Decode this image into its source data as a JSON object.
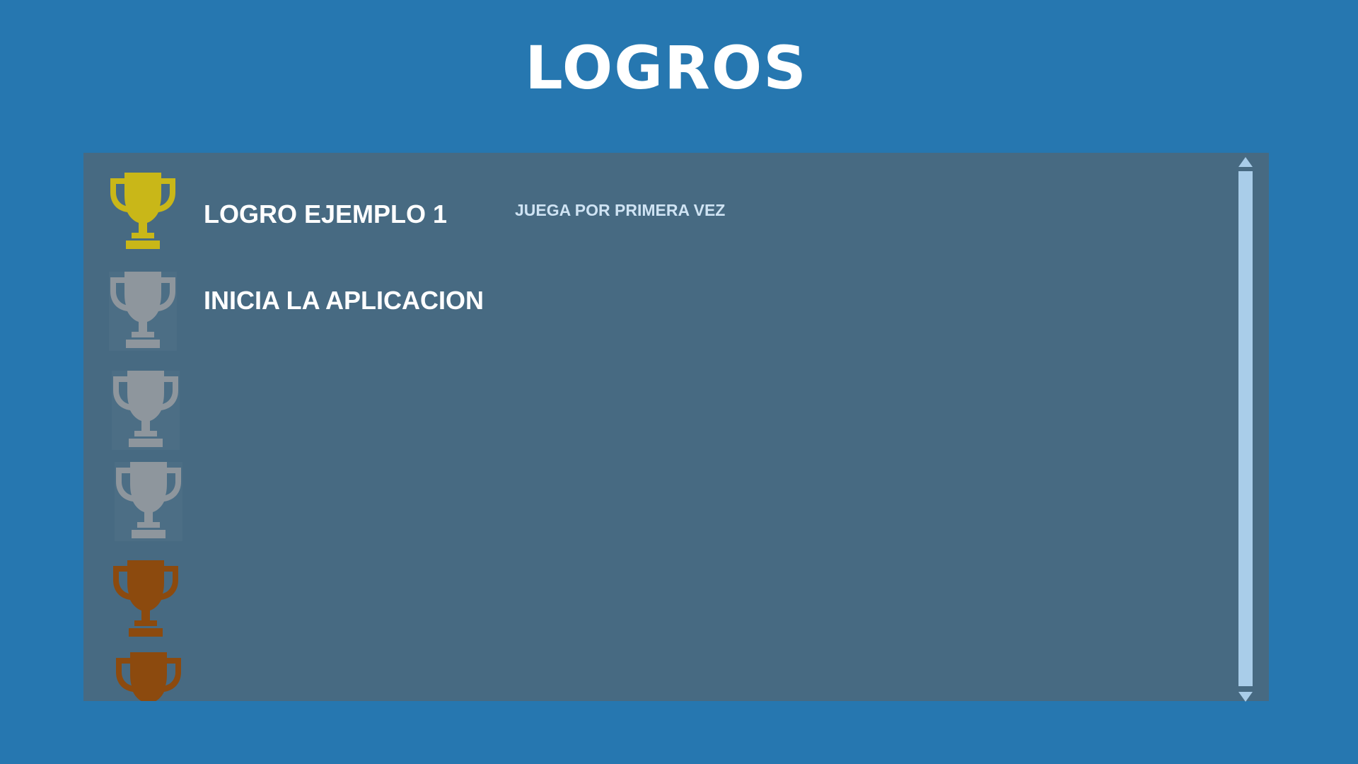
{
  "title": "LOGROS",
  "colors": {
    "background": "#2677b0",
    "panel": "#476a82",
    "gold": "#c9b718",
    "silver": "#8e969d",
    "bronze": "#8c4a0e",
    "scrollbar": "#a9cde9"
  },
  "achievements": [
    {
      "icon": "gold-trophy-icon",
      "tier": "gold",
      "unlocked": true,
      "name": "LOGRO EJEMPLO 1",
      "description": "JUEGA POR PRIMERA VEZ"
    },
    {
      "icon": "silver-trophy-icon",
      "tier": "silver",
      "unlocked": false,
      "name": "INICIA LA APLICACION",
      "description": ""
    },
    {
      "icon": "silver-trophy-icon",
      "tier": "silver",
      "unlocked": false,
      "name": "",
      "description": ""
    },
    {
      "icon": "silver-trophy-icon",
      "tier": "silver",
      "unlocked": false,
      "name": "",
      "description": ""
    },
    {
      "icon": "bronze-trophy-icon",
      "tier": "bronze",
      "unlocked": true,
      "name": "",
      "description": ""
    },
    {
      "icon": "bronze-trophy-icon",
      "tier": "bronze",
      "unlocked": true,
      "name": "",
      "description": ""
    }
  ]
}
